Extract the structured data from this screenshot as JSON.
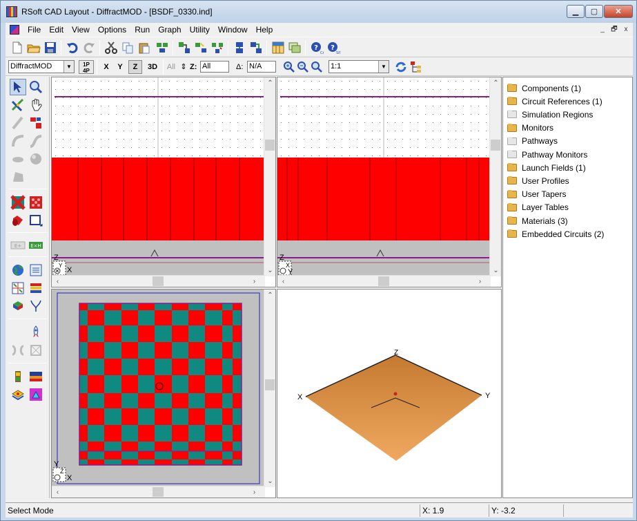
{
  "window": {
    "title": "RSoft CAD Layout - DiffractMOD - [BSDF_0330.ind]",
    "min_glyph": "▁",
    "max_glyph": "▢",
    "close_glyph": "✕"
  },
  "menu": {
    "items": [
      "File",
      "Edit",
      "View",
      "Options",
      "Run",
      "Graph",
      "Utility",
      "Window",
      "Help"
    ],
    "mdi_min": "_",
    "mdi_restore": "🗗",
    "mdi_close": "x"
  },
  "toolbar2": {
    "program": "DiffractMOD",
    "view_1p": "1P",
    "view_4p": "4P",
    "axis_x": "X",
    "axis_y": "Y",
    "axis_z": "Z",
    "view_3d": "3D",
    "all_label": "All",
    "z_label": "Z:",
    "z_value": "All",
    "delta_label": "Δ:",
    "delta_value": "N/A",
    "zoom_value": "1:1"
  },
  "palette": {
    "ex_label": "E×H",
    "ex_grey_label": "E+"
  },
  "views": {
    "top_left_axes": {
      "v": "Z",
      "h": "X",
      "o": "Y"
    },
    "top_right_axes": {
      "v": "Z",
      "h": "Y",
      "o": "X"
    },
    "bottom_left_axes": {
      "v": "Y",
      "h": "X",
      "o": "Z"
    },
    "iso_labels": {
      "x": "X",
      "y": "Y",
      "z": "Z"
    }
  },
  "tree": {
    "items": [
      {
        "label": "Components (1)",
        "state": "full"
      },
      {
        "label": "Circuit References (1)",
        "state": "full"
      },
      {
        "label": "Simulation Regions",
        "state": "empty"
      },
      {
        "label": "Monitors",
        "state": "full"
      },
      {
        "label": "Pathways",
        "state": "empty"
      },
      {
        "label": "Pathway Monitors",
        "state": "empty"
      },
      {
        "label": "Launch Fields (1)",
        "state": "full"
      },
      {
        "label": "User Profiles",
        "state": "full"
      },
      {
        "label": "User Tapers",
        "state": "full"
      },
      {
        "label": "Layer Tables",
        "state": "full"
      },
      {
        "label": "Materials (3)",
        "state": "full"
      },
      {
        "label": "Embedded Circuits (2)",
        "state": "full"
      }
    ]
  },
  "status": {
    "mode": "Select Mode",
    "x": "X: 1.9",
    "y": "Y: -3.2"
  },
  "colors": {
    "red": "#ff0000",
    "teal": "#108a80",
    "purple": "#8b1a8b",
    "substrate": "#c0c0c0",
    "plane": "#e09a55"
  }
}
